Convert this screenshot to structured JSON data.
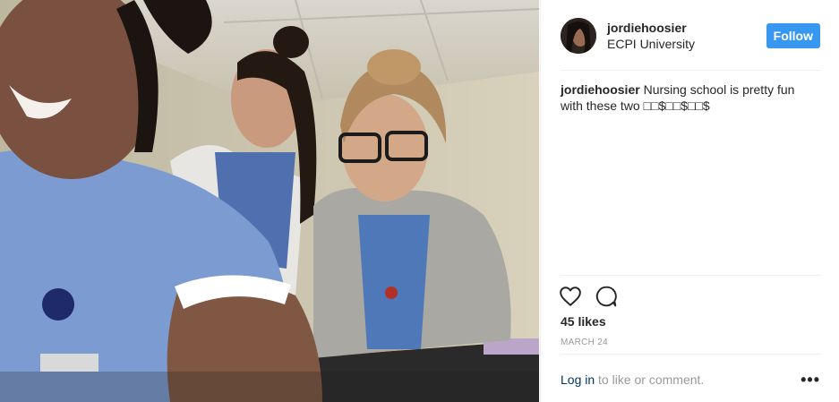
{
  "post": {
    "username": "jordiehoosier",
    "location": "ECPI University",
    "follow_label": "Follow",
    "caption_user": "jordiehoosier",
    "caption_text": "Nursing school is pretty fun with these two □□$□□$□□$",
    "likes": "45 likes",
    "date": "March 24",
    "login_link": "Log in",
    "login_rest": " to like or comment.",
    "more_label": "•••"
  },
  "icons": {
    "like": "heart-icon",
    "comment": "comment-icon",
    "more": "more-options-icon"
  },
  "colors": {
    "follow_button": "#3897f0",
    "link": "#003569",
    "muted": "#999999",
    "text": "#262626"
  }
}
